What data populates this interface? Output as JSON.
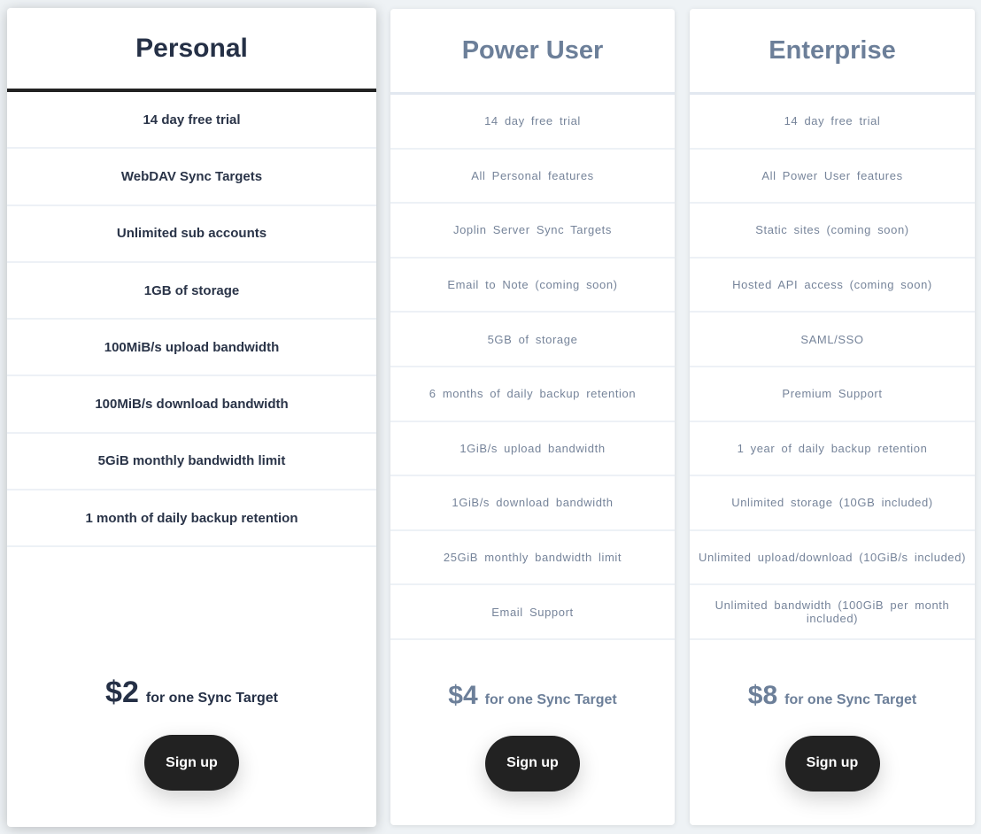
{
  "colors": {
    "background": "#eef2f5",
    "card": "#ffffff",
    "featured_text": "#253046",
    "plain_title": "#6c7f99",
    "plain_text": "#76849a",
    "button": "#222222",
    "button_text": "#ffffff"
  },
  "plans": [
    {
      "name": "Personal",
      "featured": true,
      "features": [
        "14 day free trial",
        "WebDAV Sync Targets",
        "Unlimited sub accounts",
        "1GB of storage",
        "100MiB/s upload bandwidth",
        "100MiB/s download bandwidth",
        "5GiB monthly bandwidth limit",
        "1 month of daily backup retention"
      ],
      "price": "$2",
      "price_desc": "for one Sync Target",
      "signup_label": "Sign up"
    },
    {
      "name": "Power User",
      "featured": false,
      "features": [
        "14 day free trial",
        "All Personal features",
        "Joplin Server Sync Targets",
        "Email to Note (coming soon)",
        "5GB of storage",
        "6 months of daily backup retention",
        "1GiB/s upload bandwidth",
        "1GiB/s download bandwidth",
        "25GiB monthly bandwidth limit",
        "Email Support"
      ],
      "price": "$4",
      "price_desc": "for one Sync Target",
      "signup_label": "Sign up"
    },
    {
      "name": "Enterprise",
      "featured": false,
      "features": [
        "14 day free trial",
        "All Power User features",
        "Static sites (coming soon)",
        "Hosted API access (coming soon)",
        "SAML/SSO",
        "Premium Support",
        "1 year of daily backup retention",
        "Unlimited storage (10GB included)",
        "Unlimited upload/download (10GiB/s included)",
        "Unlimited bandwidth (100GiB per month included)"
      ],
      "price": "$8",
      "price_desc": "for one Sync Target",
      "signup_label": "Sign up"
    }
  ]
}
